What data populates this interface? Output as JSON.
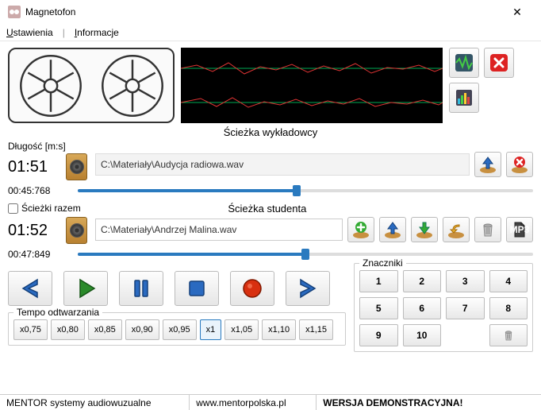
{
  "window": {
    "title": "Magnetofon",
    "close": "✕"
  },
  "menu": {
    "settings": "Ustawienia",
    "sep": "|",
    "info": "Informacje"
  },
  "track_lecturer_label": "Ścieżka wykładowcy",
  "track_student_label": "Ścieżka studenta",
  "length_label": "Długość [m:s]",
  "lecturer": {
    "length": "01:51",
    "path": "C:\\Materiały\\Audycja radiowa.wav",
    "timecode": "00:45:768",
    "progress_pct": 48
  },
  "tracks_together": "Ścieżki razem",
  "student": {
    "length": "01:52",
    "path": "C:\\Materiały\\Andrzej Malina.wav",
    "timecode": "00:47:849",
    "progress_pct": 50
  },
  "tempo": {
    "label": "Tempo odtwarzania",
    "options": [
      "x0,75",
      "x0,80",
      "x0,85",
      "x0,90",
      "x0,95",
      "x1",
      "x1,05",
      "x1,10",
      "x1,15"
    ],
    "selected": "x1"
  },
  "markers": {
    "label": "Znaczniki",
    "items": [
      "1",
      "2",
      "3",
      "4",
      "5",
      "6",
      "7",
      "8",
      "9",
      "10"
    ]
  },
  "footer": {
    "company": "MENTOR systemy audiowuzualne",
    "url": "www.mentorpolska.pl",
    "version": "WERSJA DEMONSTRACYJNA!"
  }
}
